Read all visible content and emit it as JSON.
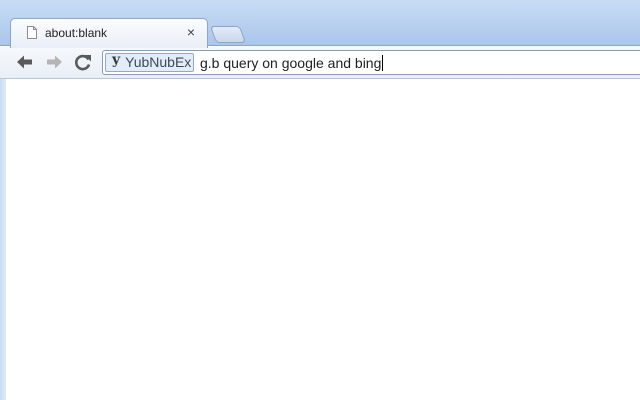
{
  "tab": {
    "title": "about:blank",
    "close_glyph": "×",
    "icon": "page-icon"
  },
  "toolbar": {
    "back_icon": "arrow-left-icon",
    "forward_icon": "arrow-right-icon",
    "reload_icon": "reload-icon"
  },
  "omnibox": {
    "keyword": {
      "icon_glyph": "y",
      "label": "YubNubEx"
    },
    "text": "g.b query on google and bing"
  },
  "colors": {
    "frame": "#c9dcf4",
    "toolbar": "#eef3f9",
    "keyword_chip": "#e3edf9"
  }
}
